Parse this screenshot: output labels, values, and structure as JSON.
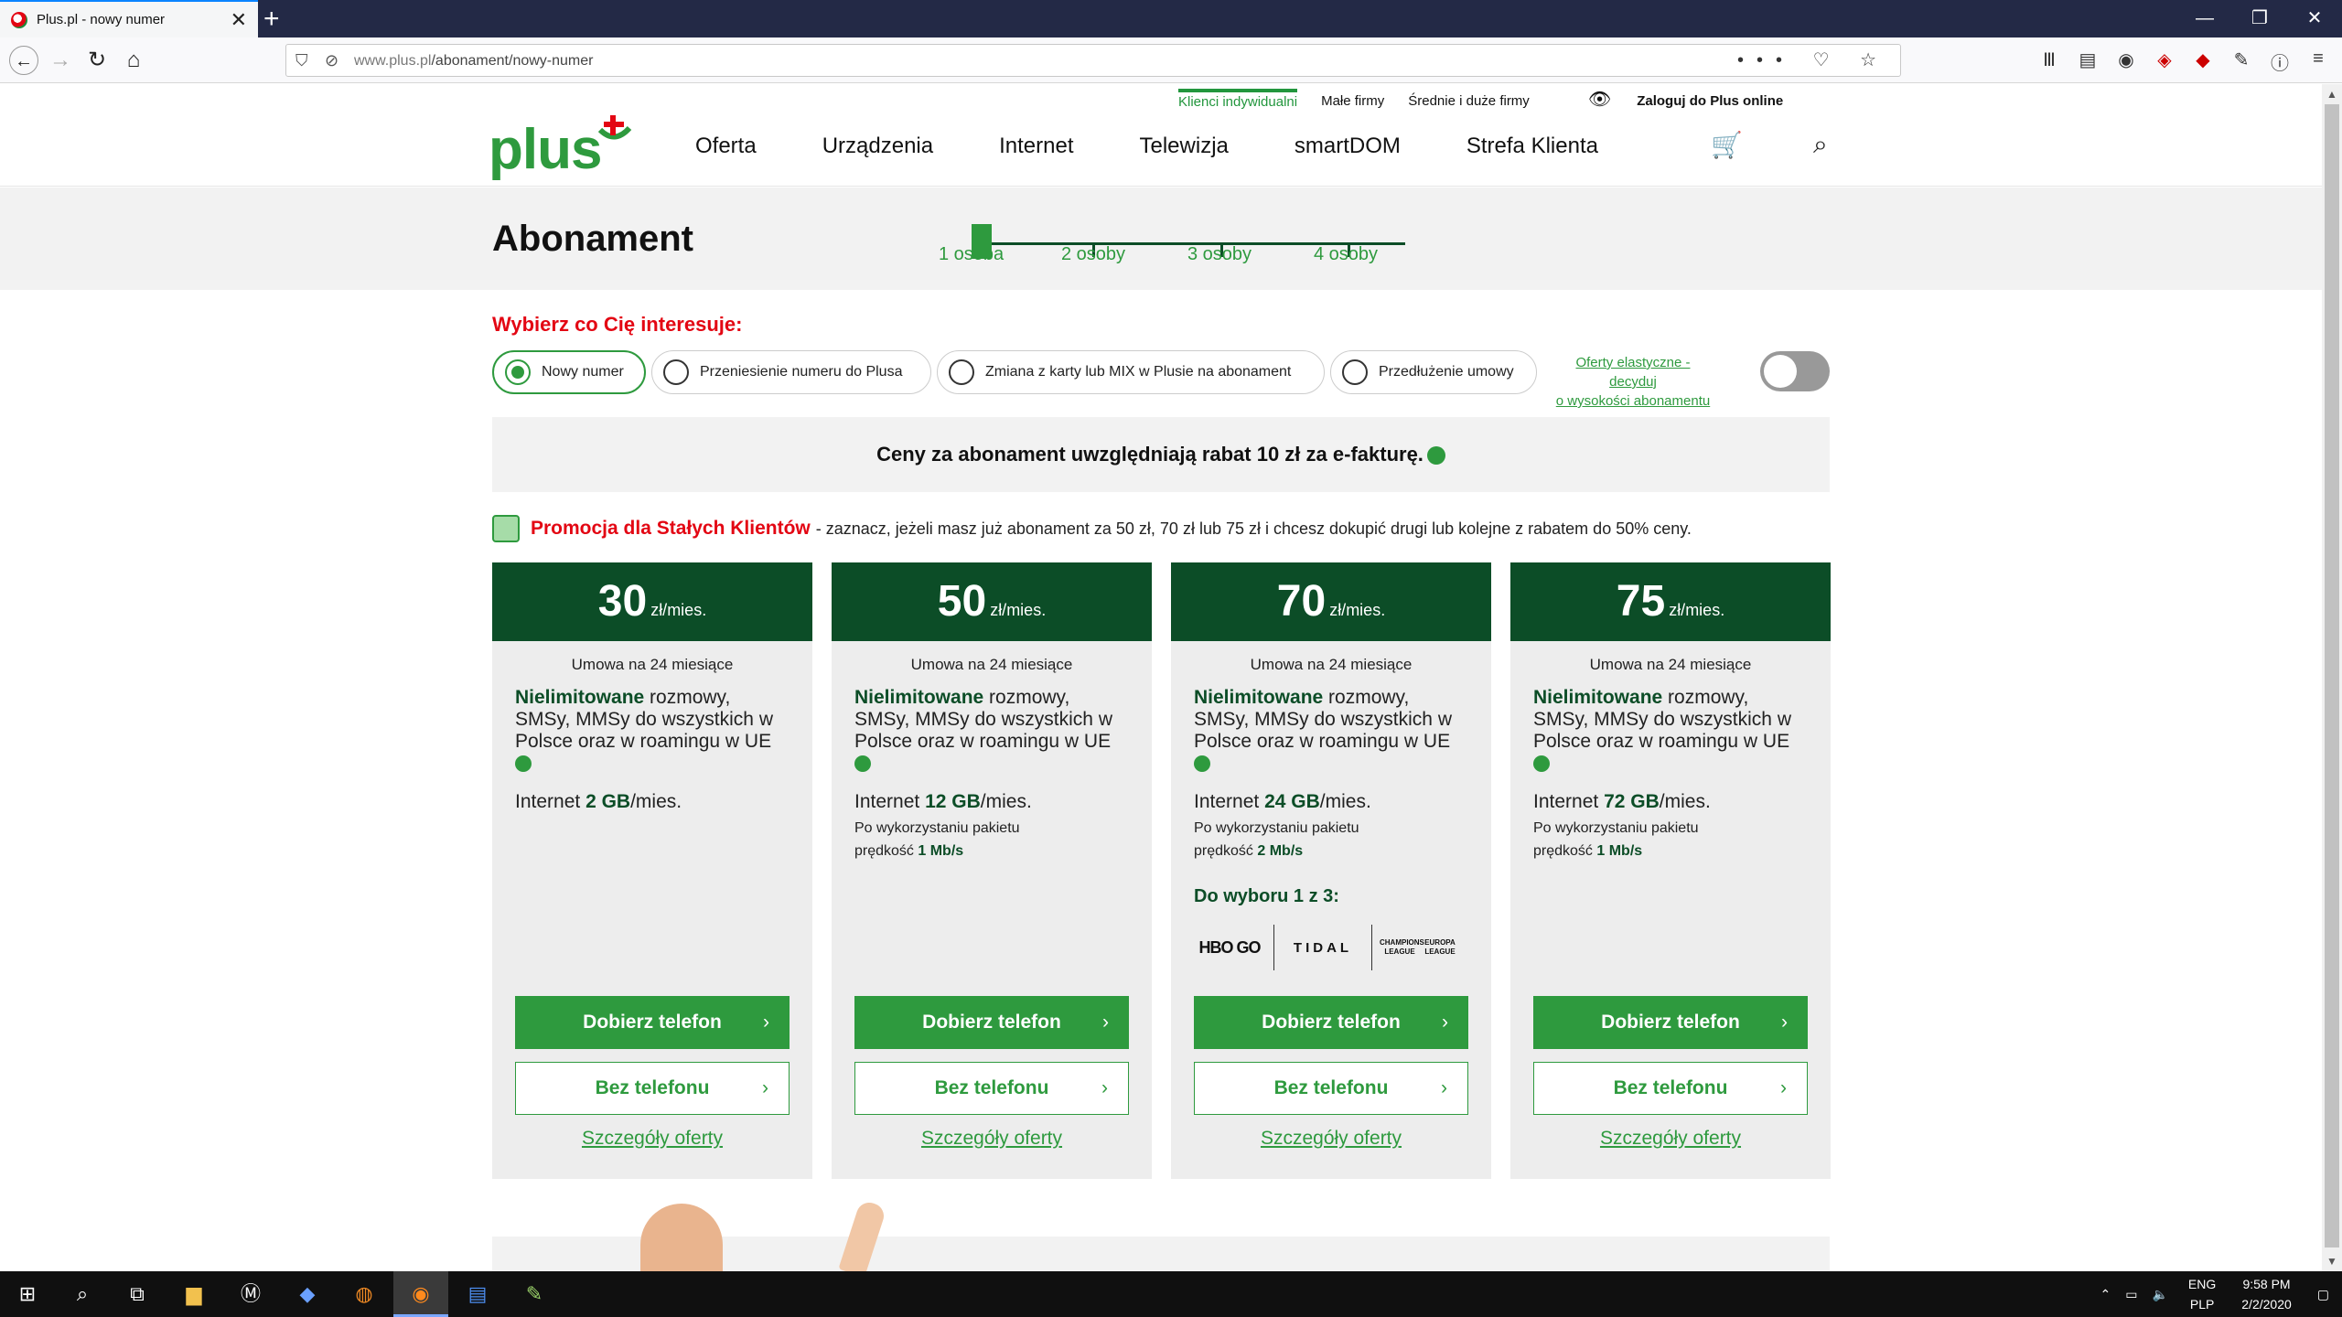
{
  "browser": {
    "tab_title": "Plus.pl - nowy numer",
    "url_host": "www.plus.pl",
    "url_path": "/abonament/nowy-numer",
    "url_actions": "••• ♡ ☆"
  },
  "site": {
    "segments": [
      "Klienci indywidualni",
      "Małe firmy",
      "Średnie i duże firmy"
    ],
    "login": "Zaloguj do Plus online",
    "logo": "plus",
    "menu": [
      "Oferta",
      "Urządzenia",
      "Internet",
      "Telewizja",
      "smartDOM",
      "Strefa Klienta"
    ]
  },
  "hero": {
    "title": "Abonament",
    "steps": [
      "1 osoba",
      "2 osoby",
      "3 osoby",
      "4 osoby"
    ]
  },
  "filter": {
    "heading": "Wybierz co Cię interesuje:",
    "options": [
      "Nowy numer",
      "Przeniesienie numeru do Plusa",
      "Zmiana z karty lub MIX w Plusie na abonament",
      "Przedłużenie umowy"
    ],
    "elastic_line1": "Oferty elastyczne - decyduj",
    "elastic_line2": "o wysokości abonamentu"
  },
  "info_banner": "Ceny za abonament uwzględniają rabat 10 zł za e-fakturę.",
  "promo": {
    "title": "Promocja dla Stałych Klientów",
    "text": "- zaznacz, jeżeli masz już abonament za 50 zł, 70 zł lub 75 zł i chcesz dokupić drugi lub kolejne z rabatem do 50% ceny."
  },
  "plans": [
    {
      "price": "30",
      "unit": "zł/mies.",
      "contract": "Umowa na 24 miesiące",
      "unl": "Nielimitowane",
      "desc": " rozmowy, SMSy, MMSy do wszystkich w Polsce oraz w roamingu w UE",
      "net_pre": "Internet ",
      "net_val": "2 GB",
      "net_post": "/mies.",
      "after_pre": "",
      "after_line2": "",
      "speed": ""
    },
    {
      "price": "50",
      "unit": "zł/mies.",
      "contract": "Umowa na 24 miesiące",
      "unl": "Nielimitowane",
      "desc": " rozmowy, SMSy, MMSy do wszystkich w Polsce oraz w roamingu w UE",
      "net_pre": "Internet ",
      "net_val": "12 GB",
      "net_post": "/mies.",
      "after_pre": "Po wykorzystaniu pakietu",
      "after_line2": "prędkość ",
      "speed": "1 Mb/s"
    },
    {
      "price": "70",
      "unit": "zł/mies.",
      "contract": "Umowa na 24 miesiące",
      "unl": "Nielimitowane",
      "desc": " rozmowy, SMSy, MMSy do wszystkich w Polsce oraz w roamingu w UE",
      "net_pre": "Internet ",
      "net_val": "24 GB",
      "net_post": "/mies.",
      "after_pre": "Po wykorzystaniu pakietu",
      "after_line2": "prędkość ",
      "speed": "2 Mb/s",
      "choice": "Do wyboru 1 z 3:",
      "choice_logos": [
        "HBO GO",
        "TIDAL",
        "CHAMPIONS LEAGUE",
        "EUROPA LEAGUE"
      ]
    },
    {
      "price": "75",
      "unit": "zł/mies.",
      "contract": "Umowa na 24 miesiące",
      "unl": "Nielimitowane",
      "desc": " rozmowy, SMSy, MMSy do wszystkich w Polsce oraz w roamingu w UE",
      "net_pre": "Internet ",
      "net_val": "72 GB",
      "net_post": "/mies.",
      "after_pre": "Po wykorzystaniu pakietu",
      "after_line2": "prędkość ",
      "speed": "1 Mb/s"
    }
  ],
  "buttons": {
    "with_phone": "Dobierz telefon",
    "without_phone": "Bez telefonu",
    "details": "Szczegóły oferty"
  },
  "taskbar": {
    "lang": "ENG",
    "lang2": "PLP",
    "time": "9:58 PM",
    "date": "2/2/2020"
  },
  "colors": {
    "brand_green": "#2e9a3e",
    "dark_green": "#0c4d27",
    "accent_red": "#e30613"
  }
}
